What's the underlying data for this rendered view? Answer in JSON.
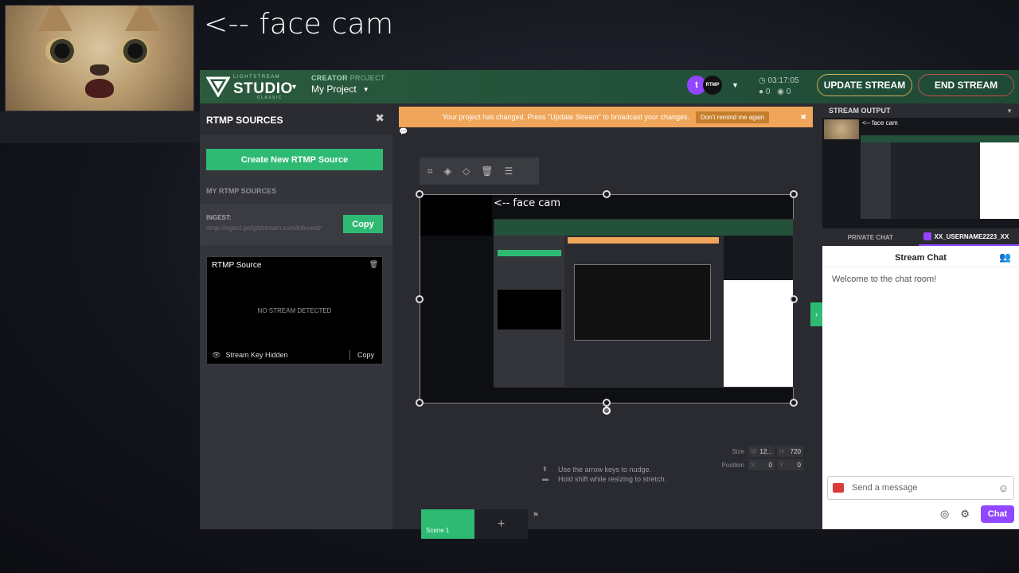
{
  "overlay": {
    "label": "<-- face cam"
  },
  "topbar": {
    "logo_small": "LIGHTSTREAM",
    "logo_big": "STUDIO",
    "logo_sub": "CLASSIC",
    "project_label": "CREATOR",
    "project_label_suffix": "PROJECT",
    "project_name": "My Project",
    "platform_twitch": "t",
    "platform_rtmp": "RTMP",
    "timer": "03:17:05",
    "viewers": "0",
    "followers": "0",
    "update_stream": "UPDATE STREAM",
    "end_stream": "END STREAM",
    "colors": {
      "accent_green": "#2fba73",
      "twitch_purple": "#9146ff",
      "warning": "#f0a65a"
    }
  },
  "left": {
    "title": "RTMP SOURCES",
    "create_button": "Create New RTMP Source",
    "my_sources": "MY RTMP SOURCES",
    "ingest_label": "INGEST:",
    "ingest_url": "rtmp://ingest.golightstream.com/inbound/",
    "copy": "Copy",
    "card_title": "RTMP Source",
    "no_stream": "NO STREAM DETECTED",
    "stream_key": "Stream Key Hidden",
    "card_copy": "Copy"
  },
  "center": {
    "notice": "Your project has changed. Press \"Update Stream\" to broadcast your changes.",
    "notice_btn": "Don't remind me again",
    "canvas_label": "<-- face cam",
    "hint1": "Use the arrow keys to nudge.",
    "hint2": "Hold shift while resizing to stretch.",
    "size_label": "Size",
    "size_w_key": "W",
    "size_w": "12...",
    "size_h_key": "H",
    "size_h": "720",
    "position_label": "Position",
    "pos_x_key": "X",
    "pos_x": "0",
    "pos_y_key": "Y",
    "pos_y": "0",
    "scene1": "Scene 1",
    "scene_add": "+"
  },
  "right": {
    "output_title": "STREAM OUTPUT",
    "output_preview_label": "<-- face cam",
    "tab_private": "PRIVATE CHAT",
    "tab_stream": "XX_USERNAME2223_XX",
    "chat_title": "Stream Chat",
    "welcome": "Welcome to the chat room!",
    "message_placeholder": "Send a message",
    "chat_button": "Chat"
  }
}
